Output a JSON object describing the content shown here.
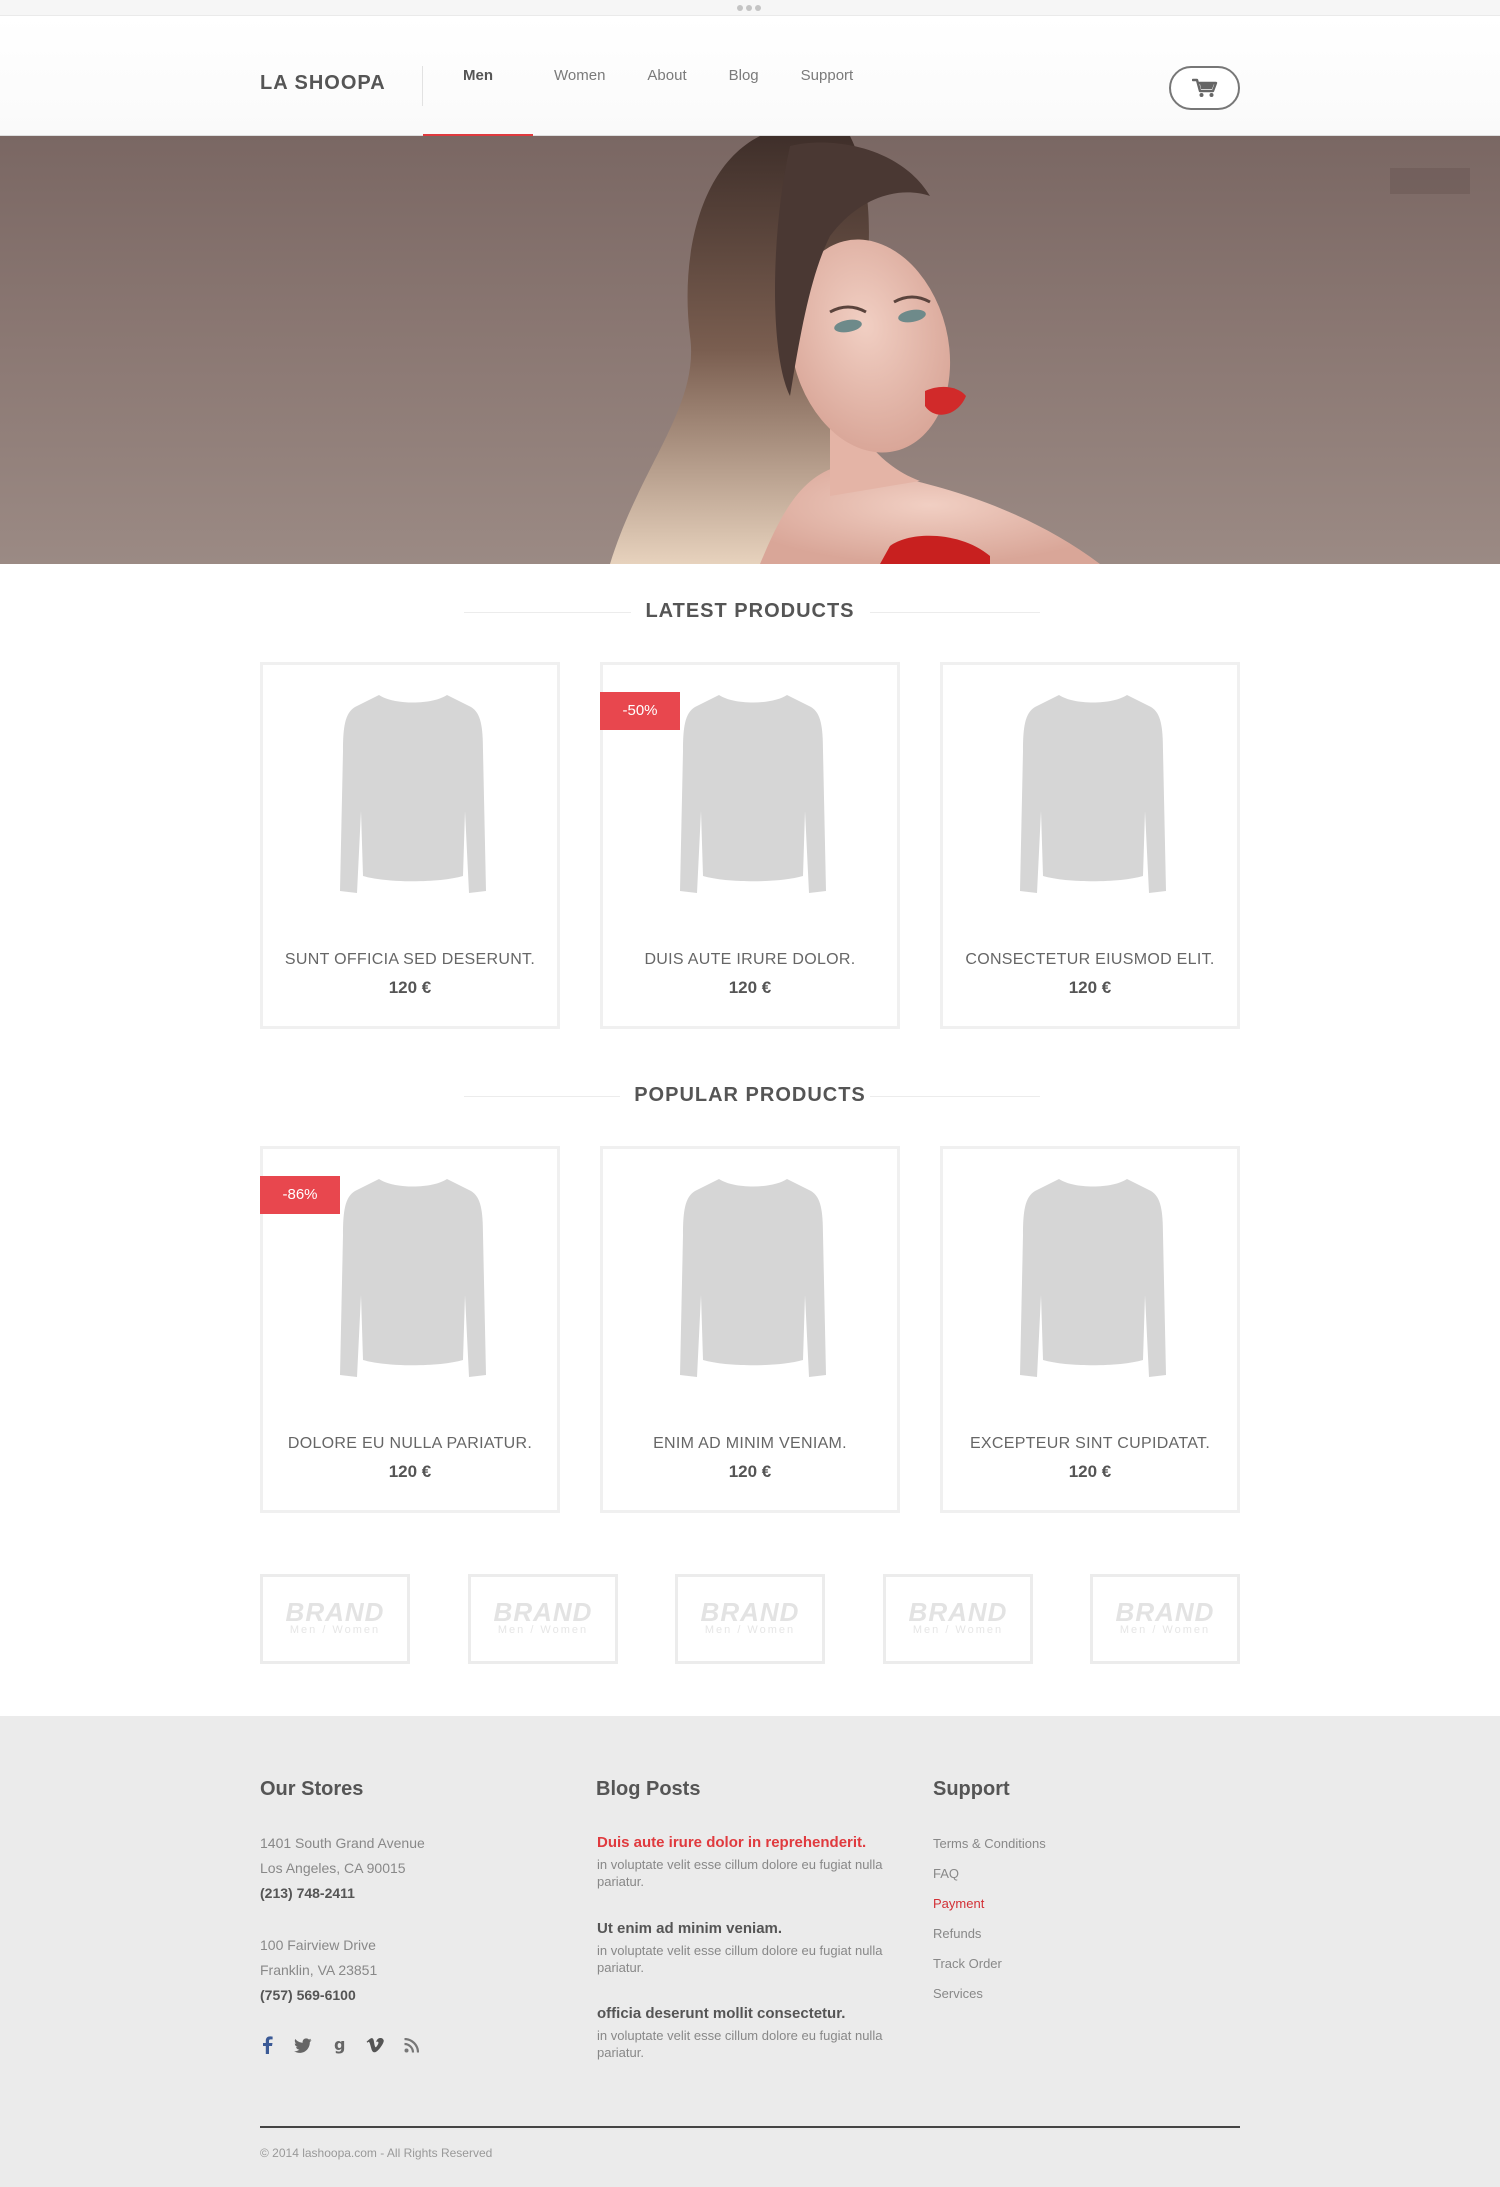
{
  "header": {
    "logo": "LA SHOOPA",
    "nav": [
      "Men",
      "Women",
      "About",
      "Blog",
      "Support"
    ],
    "active_nav": "Men",
    "accent": "#e03a3e"
  },
  "hero": {
    "image": "woman-portrait",
    "palette": [
      "#7a6763",
      "#9b8a84",
      "#d12a2a"
    ]
  },
  "latest": {
    "title": "LATEST PRODUCTS",
    "products": [
      {
        "name": "SUNT OFFICIA SED DESERUNT.",
        "price": "120 €",
        "badge": ""
      },
      {
        "name": "DUIS AUTE IRURE DOLOR.",
        "price": "120 €",
        "badge": "-50%"
      },
      {
        "name": "CONSECTETUR EIUSMOD ELIT.",
        "price": "120 €",
        "badge": ""
      }
    ]
  },
  "popular": {
    "title": "POPULAR PRODUCTS",
    "products": [
      {
        "name": "DOLORE EU NULLA PARIATUR.",
        "price": "120 €",
        "badge": "-86%"
      },
      {
        "name": "ENIM AD MINIM VENIAM.",
        "price": "120 €",
        "badge": ""
      },
      {
        "name": "EXCEPTEUR SINT CUPIDATAT.",
        "price": "120 €",
        "badge": ""
      }
    ]
  },
  "brands": [
    {
      "name": "BRAND",
      "sub": "Men / Women"
    },
    {
      "name": "BRAND",
      "sub": "Men / Women"
    },
    {
      "name": "BRAND",
      "sub": "Men / Women"
    },
    {
      "name": "BRAND",
      "sub": "Men / Women"
    },
    {
      "name": "BRAND",
      "sub": "Men / Women"
    }
  ],
  "footer": {
    "stores": {
      "title": "Our Stores",
      "store1": {
        "street": "1401 South Grand Avenue",
        "city": "Los Angeles, CA 90015",
        "phone": "(213) 748-2411"
      },
      "store2": {
        "street": "100 Fairview Drive",
        "city": "Franklin, VA 23851",
        "phone": "(757) 569-6100"
      },
      "social": [
        "facebook-icon",
        "twitter-icon",
        "google-icon",
        "vimeo-icon",
        "rss-icon"
      ]
    },
    "blog": {
      "title": "Blog Posts",
      "posts": [
        {
          "title": "Duis aute irure dolor in reprehenderit.",
          "excerpt": " in voluptate velit esse cillum dolore eu fugiat nulla pariatur."
        },
        {
          "title": "Ut enim ad minim veniam.",
          "excerpt": " in voluptate velit esse cillum dolore eu fugiat nulla pariatur."
        },
        {
          "title": "officia deserunt mollit consectetur.",
          "excerpt": " in voluptate velit esse cillum dolore eu fugiat nulla pariatur."
        }
      ]
    },
    "support": {
      "title": "Support",
      "links": [
        "Terms & Conditions",
        "FAQ",
        "Payment",
        "Refunds",
        "Track Order",
        "Services"
      ],
      "active": "Payment"
    },
    "copyright": "© 2014 lashoopa.com  -  All Rights Reserved"
  }
}
